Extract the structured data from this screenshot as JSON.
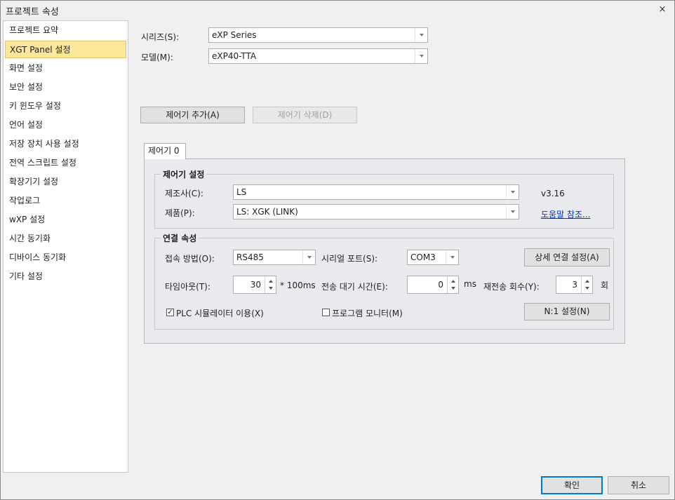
{
  "window": {
    "title": "프로젝트 속성",
    "close_glyph": "×"
  },
  "sidebar": {
    "items": [
      {
        "label": "프로젝트 요약",
        "selected": false
      },
      {
        "label": "XGT Panel 설정",
        "selected": true
      },
      {
        "label": "화면 설정",
        "selected": false
      },
      {
        "label": "보안 설정",
        "selected": false
      },
      {
        "label": "키 윈도우 설정",
        "selected": false
      },
      {
        "label": "언어 설정",
        "selected": false
      },
      {
        "label": "저장 장치 사용 설정",
        "selected": false
      },
      {
        "label": "전역 스크립트 설정",
        "selected": false
      },
      {
        "label": "확장기기 설정",
        "selected": false
      },
      {
        "label": "작업로그",
        "selected": false
      },
      {
        "label": "wXP 설정",
        "selected": false
      },
      {
        "label": "시간 동기화",
        "selected": false
      },
      {
        "label": "디바이스 동기화",
        "selected": false
      },
      {
        "label": "기타 설정",
        "selected": false
      }
    ]
  },
  "main": {
    "series_label": "시리즈(S):",
    "series_value": "eXP Series",
    "model_label": "모델(M):",
    "model_value": "eXP40-TTA",
    "add_controller": "제어기 추가(A)",
    "delete_controller": "제어기 삭제(D)",
    "tab_label": "제어기 0",
    "controller_group": {
      "title": "제어기 설정",
      "maker_label": "제조사(C):",
      "maker_value": "LS",
      "version": "v3.16",
      "product_label": "제품(P):",
      "product_value": "LS: XGK (LINK)",
      "help_link": "도움말 참조..."
    },
    "connection_group": {
      "title": "연결 속성",
      "method_label": "접속 방법(O):",
      "method_value": "RS485",
      "serial_port_label": "시리얼 포트(S):",
      "serial_port_value": "COM3",
      "detail_button": "상세 연결 설정(A)",
      "timeout_label": "타임아웃(T):",
      "timeout_value": "30",
      "timeout_unit": "* 100ms",
      "send_wait_label": "전송 대기 시간(E):",
      "send_wait_value": "0",
      "send_wait_unit": "ms",
      "retry_label": "재전송 회수(Y):",
      "retry_value": "3",
      "retry_unit": "회",
      "plc_sim_label": "PLC 시뮬레이터 이용(X)",
      "plc_sim_checked": true,
      "program_monitor_label": "프로그램 모니터(M)",
      "program_monitor_checked": false,
      "n1_button": "N:1 설정(N)"
    }
  },
  "footer": {
    "ok": "확인",
    "cancel": "취소"
  }
}
